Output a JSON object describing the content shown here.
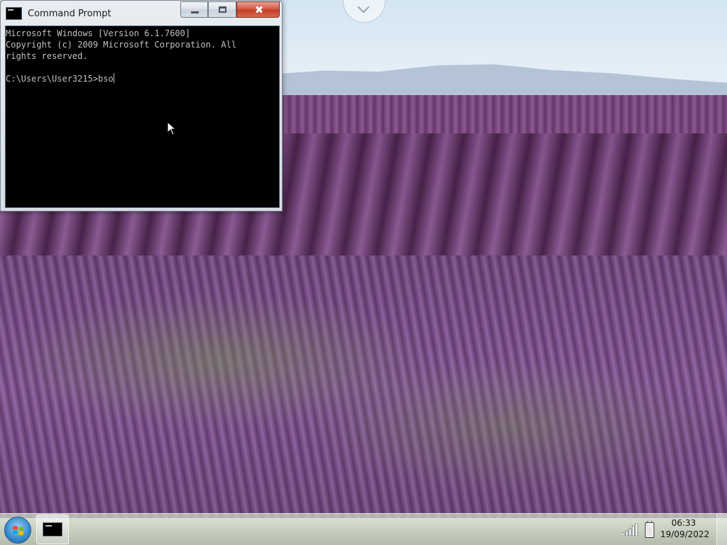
{
  "window": {
    "title": "Command Prompt",
    "close_glyph": "✖"
  },
  "console": {
    "lines": [
      "Microsoft Windows [Version 6.1.7600]",
      "Copyright (c) 2009 Microsoft Corporation. All",
      "rights reserved.",
      "",
      "C:\\Users\\User3215>bso"
    ]
  },
  "taskbar": {
    "clock_time": "06:33",
    "clock_date": "19/09/2022"
  },
  "icons": {
    "start": "windows-logo-icon",
    "taskbar_app": "command-prompt-icon",
    "signal": "signal-strength-icon",
    "battery": "battery-icon"
  },
  "colors": {
    "console_bg": "#000000",
    "console_fg": "#c0c0c0",
    "close_button": "#c33b23"
  }
}
